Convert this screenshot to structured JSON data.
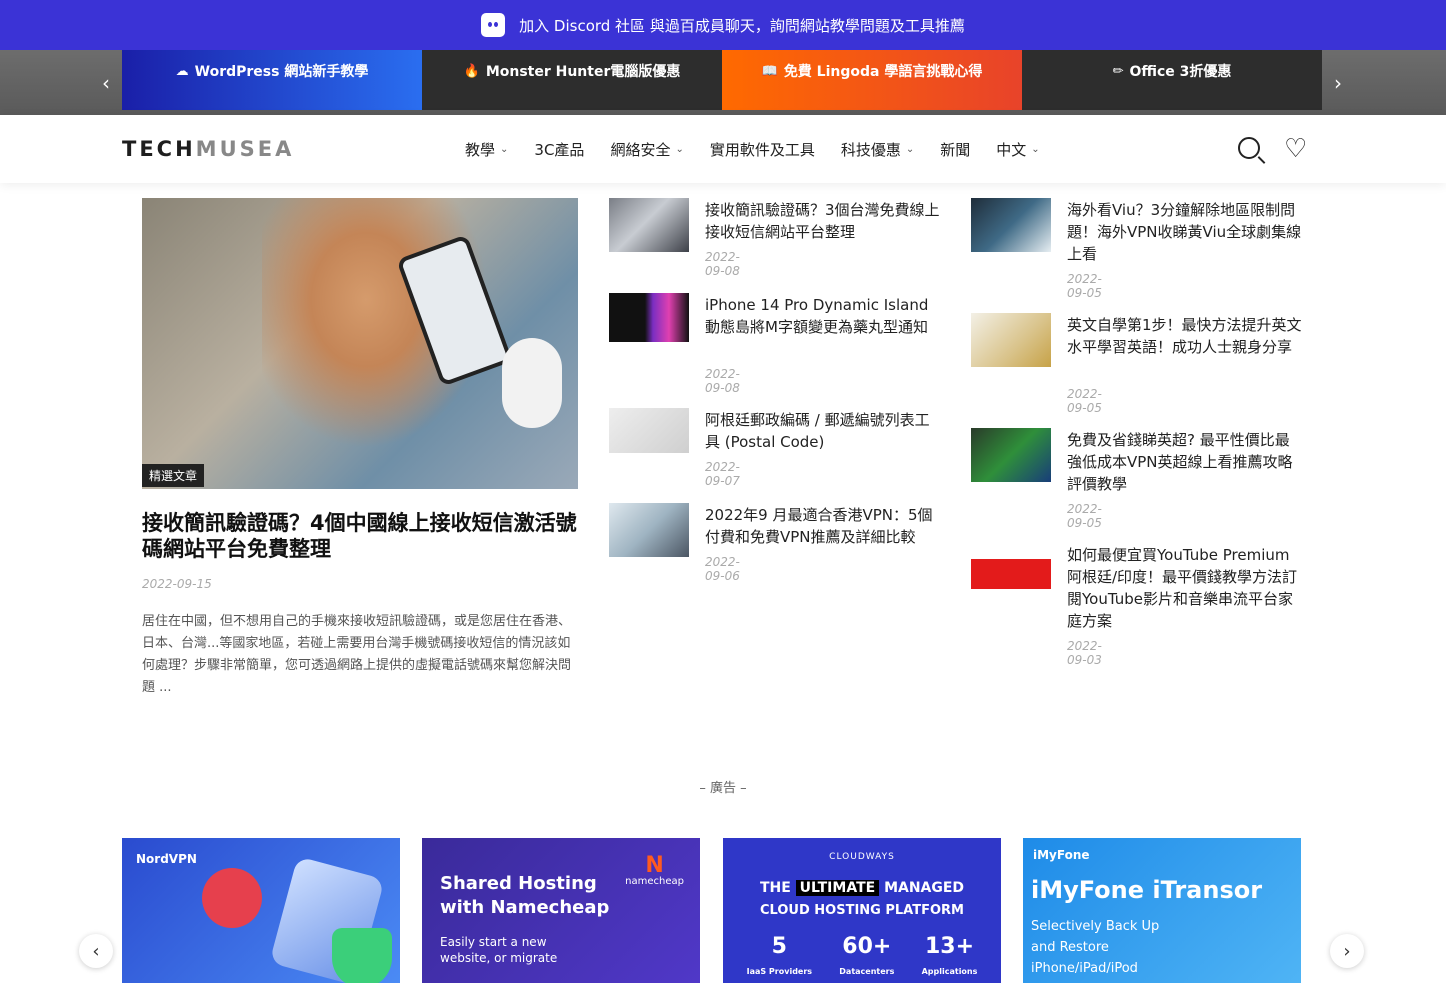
{
  "discord": {
    "text": "加入 Discord 社區 與過百成員聊天，詢問網站教學問題及工具推薦",
    "icon": "discord-icon"
  },
  "promo": {
    "tabs": [
      {
        "icon": "☁",
        "label": "WordPress 網站新手教學"
      },
      {
        "icon": "🔥",
        "label": "Monster Hunter電腦版優惠"
      },
      {
        "icon": "📖",
        "label": "免費 Lingoda 學語言挑戰心得"
      },
      {
        "icon": "✏",
        "label": "Office 3折優惠"
      }
    ],
    "prev": "‹",
    "next": "›"
  },
  "header": {
    "logo_a": "TECH",
    "logo_b": "MUSEA",
    "nav": [
      {
        "label": "教學",
        "dropdown": true
      },
      {
        "label": "3C產品",
        "dropdown": false
      },
      {
        "label": "網絡安全",
        "dropdown": true
      },
      {
        "label": "實用軟件及工具",
        "dropdown": false
      },
      {
        "label": "科技優惠",
        "dropdown": true
      },
      {
        "label": "新聞",
        "dropdown": false
      },
      {
        "label": "中文",
        "dropdown": true
      }
    ],
    "heart": "♡"
  },
  "featured": {
    "badge": "精選文章",
    "title": "接收簡訊驗證碼？4個中國線上接收短信激活號碼網站平台免費整理",
    "date": "2022-09-15",
    "excerpt": "居住在中國，但不想用自己的手機來接收短訊驗證碼，或是您居住在香港、日本、台灣...等國家地區，若碰上需要用台灣手機號碼接收短信的情況該如何處理？步驟非常簡單，您可透過網路上提供的虛擬電話號碼來幫您解決問題 ..."
  },
  "articles_mid": [
    {
      "title": "接收簡訊驗證碼？3個台灣免費線上接收短信網站平台整理",
      "date": "2022-09-08"
    },
    {
      "title": "iPhone 14 Pro Dynamic Island 動態島將M字額變更為藥丸型通知",
      "date": "2022-09-08"
    },
    {
      "title": "阿根廷郵政編碼 / 郵遞編號列表工具 (Postal Code)",
      "date": "2022-09-07"
    },
    {
      "title": "2022年9 月最適合香港VPN：5個付費和免費VPN推薦及詳細比較",
      "date": "2022-09-06"
    }
  ],
  "articles_right": [
    {
      "title": "海外看Viu？3分鐘解除地區限制問題！海外VPN收睇黃Viu全球劇集線上看",
      "date": "2022-09-05"
    },
    {
      "title": "英文自學第1步！最快方法提升英文水平學習英語！成功人士親身分享",
      "date": "2022-09-05"
    },
    {
      "title": "免費及省錢睇英超? 最平性價比最強低成本VPN英超線上看推薦攻略評價教學",
      "date": "2022-09-05"
    },
    {
      "title": "如何最便宜買YouTube Premium 阿根廷/印度！最平價錢教學方法訂閱YouTube影片和音樂串流平台家庭方案",
      "date": "2022-09-03"
    }
  ],
  "ads": {
    "label": "– 廣告 –",
    "nord": {
      "brand": "NordVPN"
    },
    "namecheap": {
      "headline": "Shared Hosting with Namecheap",
      "sub": "Easily start a new website, or migrate",
      "logo": "namecheap"
    },
    "cloudways": {
      "brand": "CLOUDWAYS",
      "pre": "THE",
      "hl": "ULTIMATE",
      "post": "MANAGED",
      "line2": "CLOUD HOSTING PLATFORM",
      "stats": [
        {
          "num": "5",
          "label": "IaaS Providers"
        },
        {
          "num": "60+",
          "label": "Datacenters"
        },
        {
          "num": "13+",
          "label": "Applications"
        }
      ]
    },
    "imyfone": {
      "brand": "iMyFone",
      "title": "iMyFone iTransor",
      "sub": "Selectively Back Up and Restore iPhone/iPad/iPod"
    },
    "prev": "‹",
    "next": "›"
  }
}
